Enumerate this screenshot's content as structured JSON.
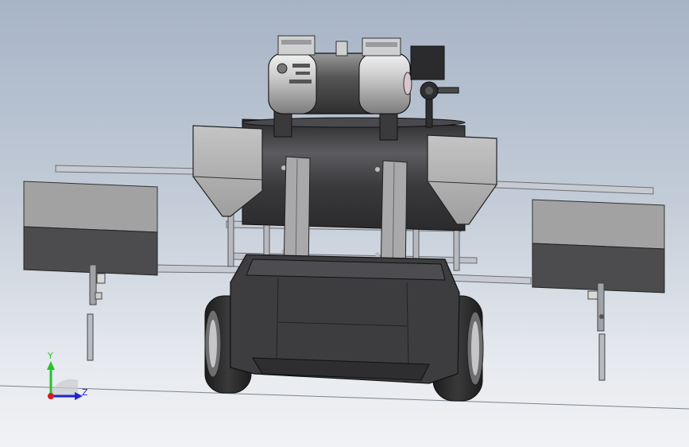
{
  "viewport": {
    "background_top": "#a7b4c6",
    "background_bottom": "#f1f2f4"
  },
  "triad": {
    "y_label": "Y",
    "z_label": "Z",
    "y_color": "#27c22b",
    "z_color": "#2323d6",
    "x_color": "#d61d1d"
  },
  "model": {
    "body_color": "#3b3b3d",
    "panel_color": "#8e8e8e",
    "box_top_color": "#9a9a9a",
    "box_bottom_color": "#4a4a4c",
    "rail_color": "#b9bcc2"
  }
}
